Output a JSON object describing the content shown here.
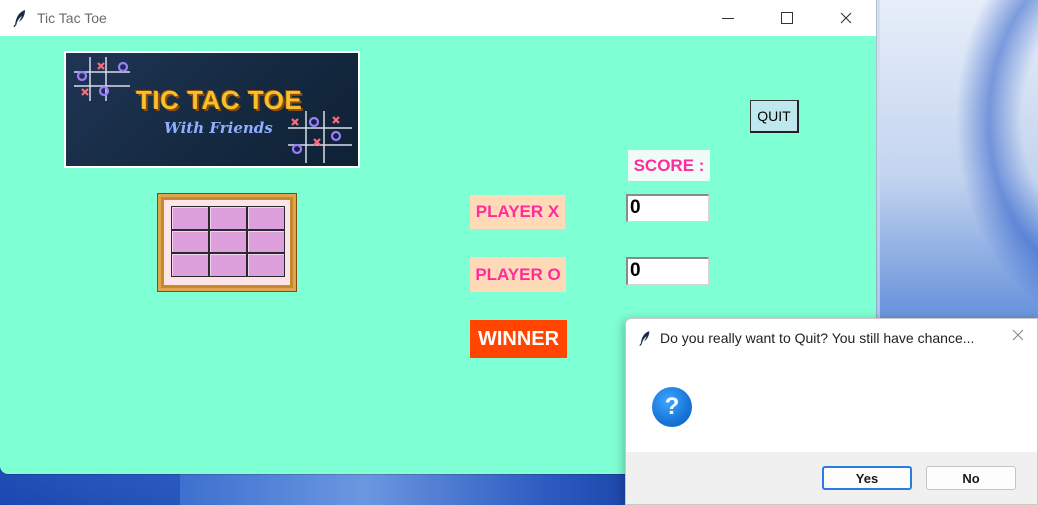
{
  "window": {
    "title": "Tic Tac Toe"
  },
  "banner": {
    "title": "TIC TAC TOE",
    "subtitle": "With Friends"
  },
  "quit_button": "QUIT",
  "score": {
    "label": "SCORE :",
    "player_x_label": "PLAYER X",
    "player_x_value": "0",
    "player_o_label": "PLAYER O",
    "player_o_value": "0"
  },
  "winner_label": "WINNER",
  "dialog": {
    "title": "Do you really want to Quit? You still have chance...",
    "yes": "Yes",
    "no": "No"
  },
  "board": {
    "rows": 3,
    "cols": 3,
    "cell_color": "#dda0dd"
  },
  "colors": {
    "background": "#7fffd4",
    "label_pink": "#ff2c9c",
    "label_bg": "#ffdab9",
    "winner_bg": "#ff4500",
    "quit_bg": "#bfe8ee"
  }
}
